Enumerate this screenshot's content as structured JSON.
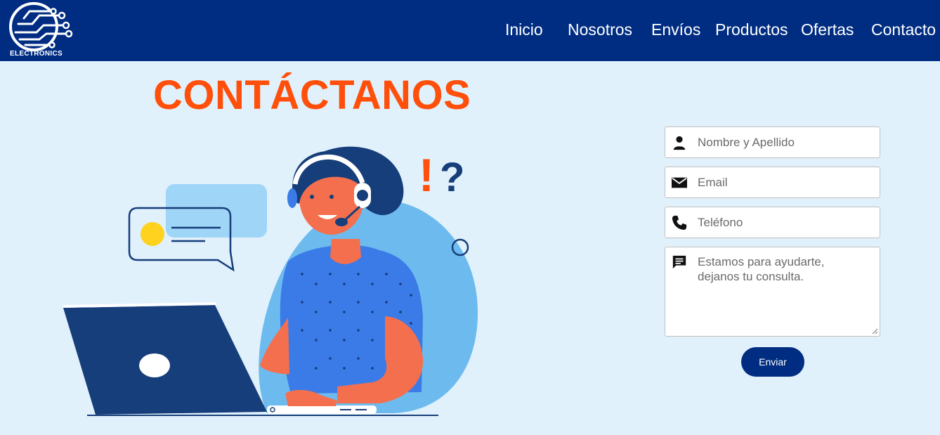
{
  "brand": {
    "logo_text": "ELECTRONICS"
  },
  "nav": {
    "items": [
      {
        "label": "Inicio"
      },
      {
        "label": "Nosotros"
      },
      {
        "label": "Envíos"
      },
      {
        "label": "Productos"
      },
      {
        "label": "Ofertas"
      },
      {
        "label": "Contacto"
      }
    ]
  },
  "hero": {
    "title": "CONTÁCTANOS"
  },
  "illustration": {
    "exclamation": "!",
    "question": "?",
    "icon": "customer-support-agent-illustration",
    "colors": {
      "accent": "#ff4f0a",
      "navy": "#163e7a",
      "blue": "#3a7be8",
      "light_blue": "#6dbbee",
      "skin": "#f46f4e"
    }
  },
  "form": {
    "name_placeholder": "Nombre y Apellido",
    "email_placeholder": "Email",
    "phone_placeholder": "Teléfono",
    "message_placeholder": "Estamos para ayudarte,\ndejanos tu consulta.",
    "submit_label": "Enviar",
    "icons": [
      "user-icon",
      "envelope-icon",
      "phone-icon",
      "message-icon"
    ]
  },
  "colors": {
    "navbar": "#002d82",
    "background": "#e1f1fc",
    "title": "#ff4f0a",
    "button": "#002d82"
  }
}
